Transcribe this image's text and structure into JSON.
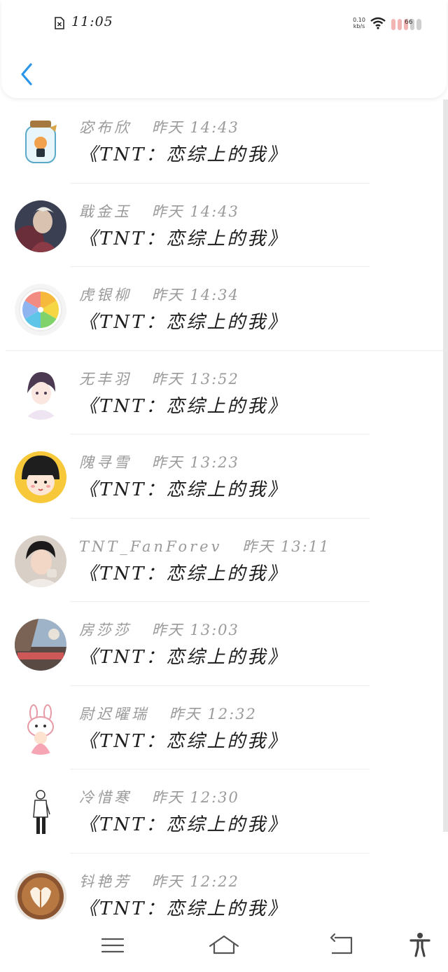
{
  "status_bar": {
    "time": "11:05",
    "net_speed_value": "0.10",
    "net_speed_unit": "kb/s",
    "battery_level": "66",
    "sim_icon": "no-sim-icon",
    "wifi_icon": "wifi-icon",
    "battery_icon": "battery-icon"
  },
  "header": {
    "back_icon": "chevron-left-icon",
    "accent_color": "#2b95e9"
  },
  "messages": [
    {
      "name": "宓布欣",
      "time": "昨天 14:43",
      "text": "《TNT：恋综上的我》",
      "avatar": "jar-figurine-avatar"
    },
    {
      "name": "戢金玉",
      "time": "昨天 14:43",
      "text": "《TNT：恋综上的我》",
      "avatar": "game-hero-avatar"
    },
    {
      "name": "虎银柳",
      "time": "昨天 14:34",
      "text": "《TNT：恋综上的我》",
      "avatar": "citrus-slice-avatar"
    },
    {
      "name": "无丰羽",
      "time": "昨天 13:52",
      "text": "《TNT：恋综上的我》",
      "avatar": "anime-boy-avatar"
    },
    {
      "name": "隗寻雪",
      "time": "昨天 13:23",
      "text": "《TNT：恋综上的我》",
      "avatar": "cartoon-girl-avatar"
    },
    {
      "name": "TNT_FanForev",
      "time": "昨天 13:11",
      "text": "《TNT：恋综上的我》",
      "avatar": "young-man-avatar"
    },
    {
      "name": "房莎莎",
      "time": "昨天 13:03",
      "text": "《TNT：恋综上的我》",
      "avatar": "street-photo-avatar"
    },
    {
      "name": "尉迟曜瑞",
      "time": "昨天 12:32",
      "text": "《TNT：恋综上的我》",
      "avatar": "bunny-girl-avatar"
    },
    {
      "name": "冷惜寒",
      "time": "昨天 12:30",
      "text": "《TNT：恋综上的我》",
      "avatar": "sketch-figure-avatar"
    },
    {
      "name": "钭艳芳",
      "time": "昨天 12:22",
      "text": "《TNT：恋综上的我》",
      "avatar": "latte-art-avatar"
    }
  ],
  "nav_bar": {
    "menu_icon": "menu-icon",
    "home_icon": "home-icon",
    "back_icon": "back-arrow-icon",
    "accessibility_icon": "accessibility-icon"
  }
}
